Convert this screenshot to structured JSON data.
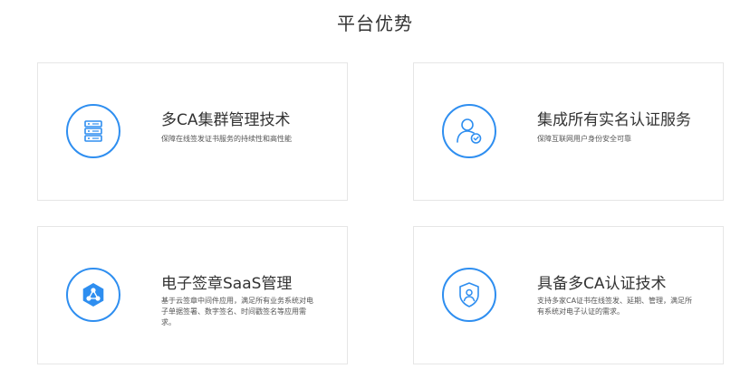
{
  "section": {
    "title": "平台优势"
  },
  "cards": [
    {
      "title": "多CA集群管理技术",
      "desc": "保障在线签发证书服务的持续性和高性能",
      "icon": "server-stack-icon"
    },
    {
      "title": "集成所有实名认证服务",
      "desc": "保障互联网用户身份安全可靠",
      "icon": "user-verified-icon"
    },
    {
      "title": "电子签章SaaS管理",
      "desc": "基于云签章中间件应用，满足所有业务系统对电子单据签署、数字签名、时间戳签名等应用需求。",
      "icon": "network-hexagon-icon"
    },
    {
      "title": "具备多CA认证技术",
      "desc": "支持多家CA证书在线签发、延期、管理，满足所有系统对电子认证的需求。",
      "icon": "shield-user-icon"
    }
  ],
  "colors": {
    "accent": "#2e8ef0",
    "border": "#e6e6e6",
    "title": "#333333",
    "text": "#555555"
  }
}
